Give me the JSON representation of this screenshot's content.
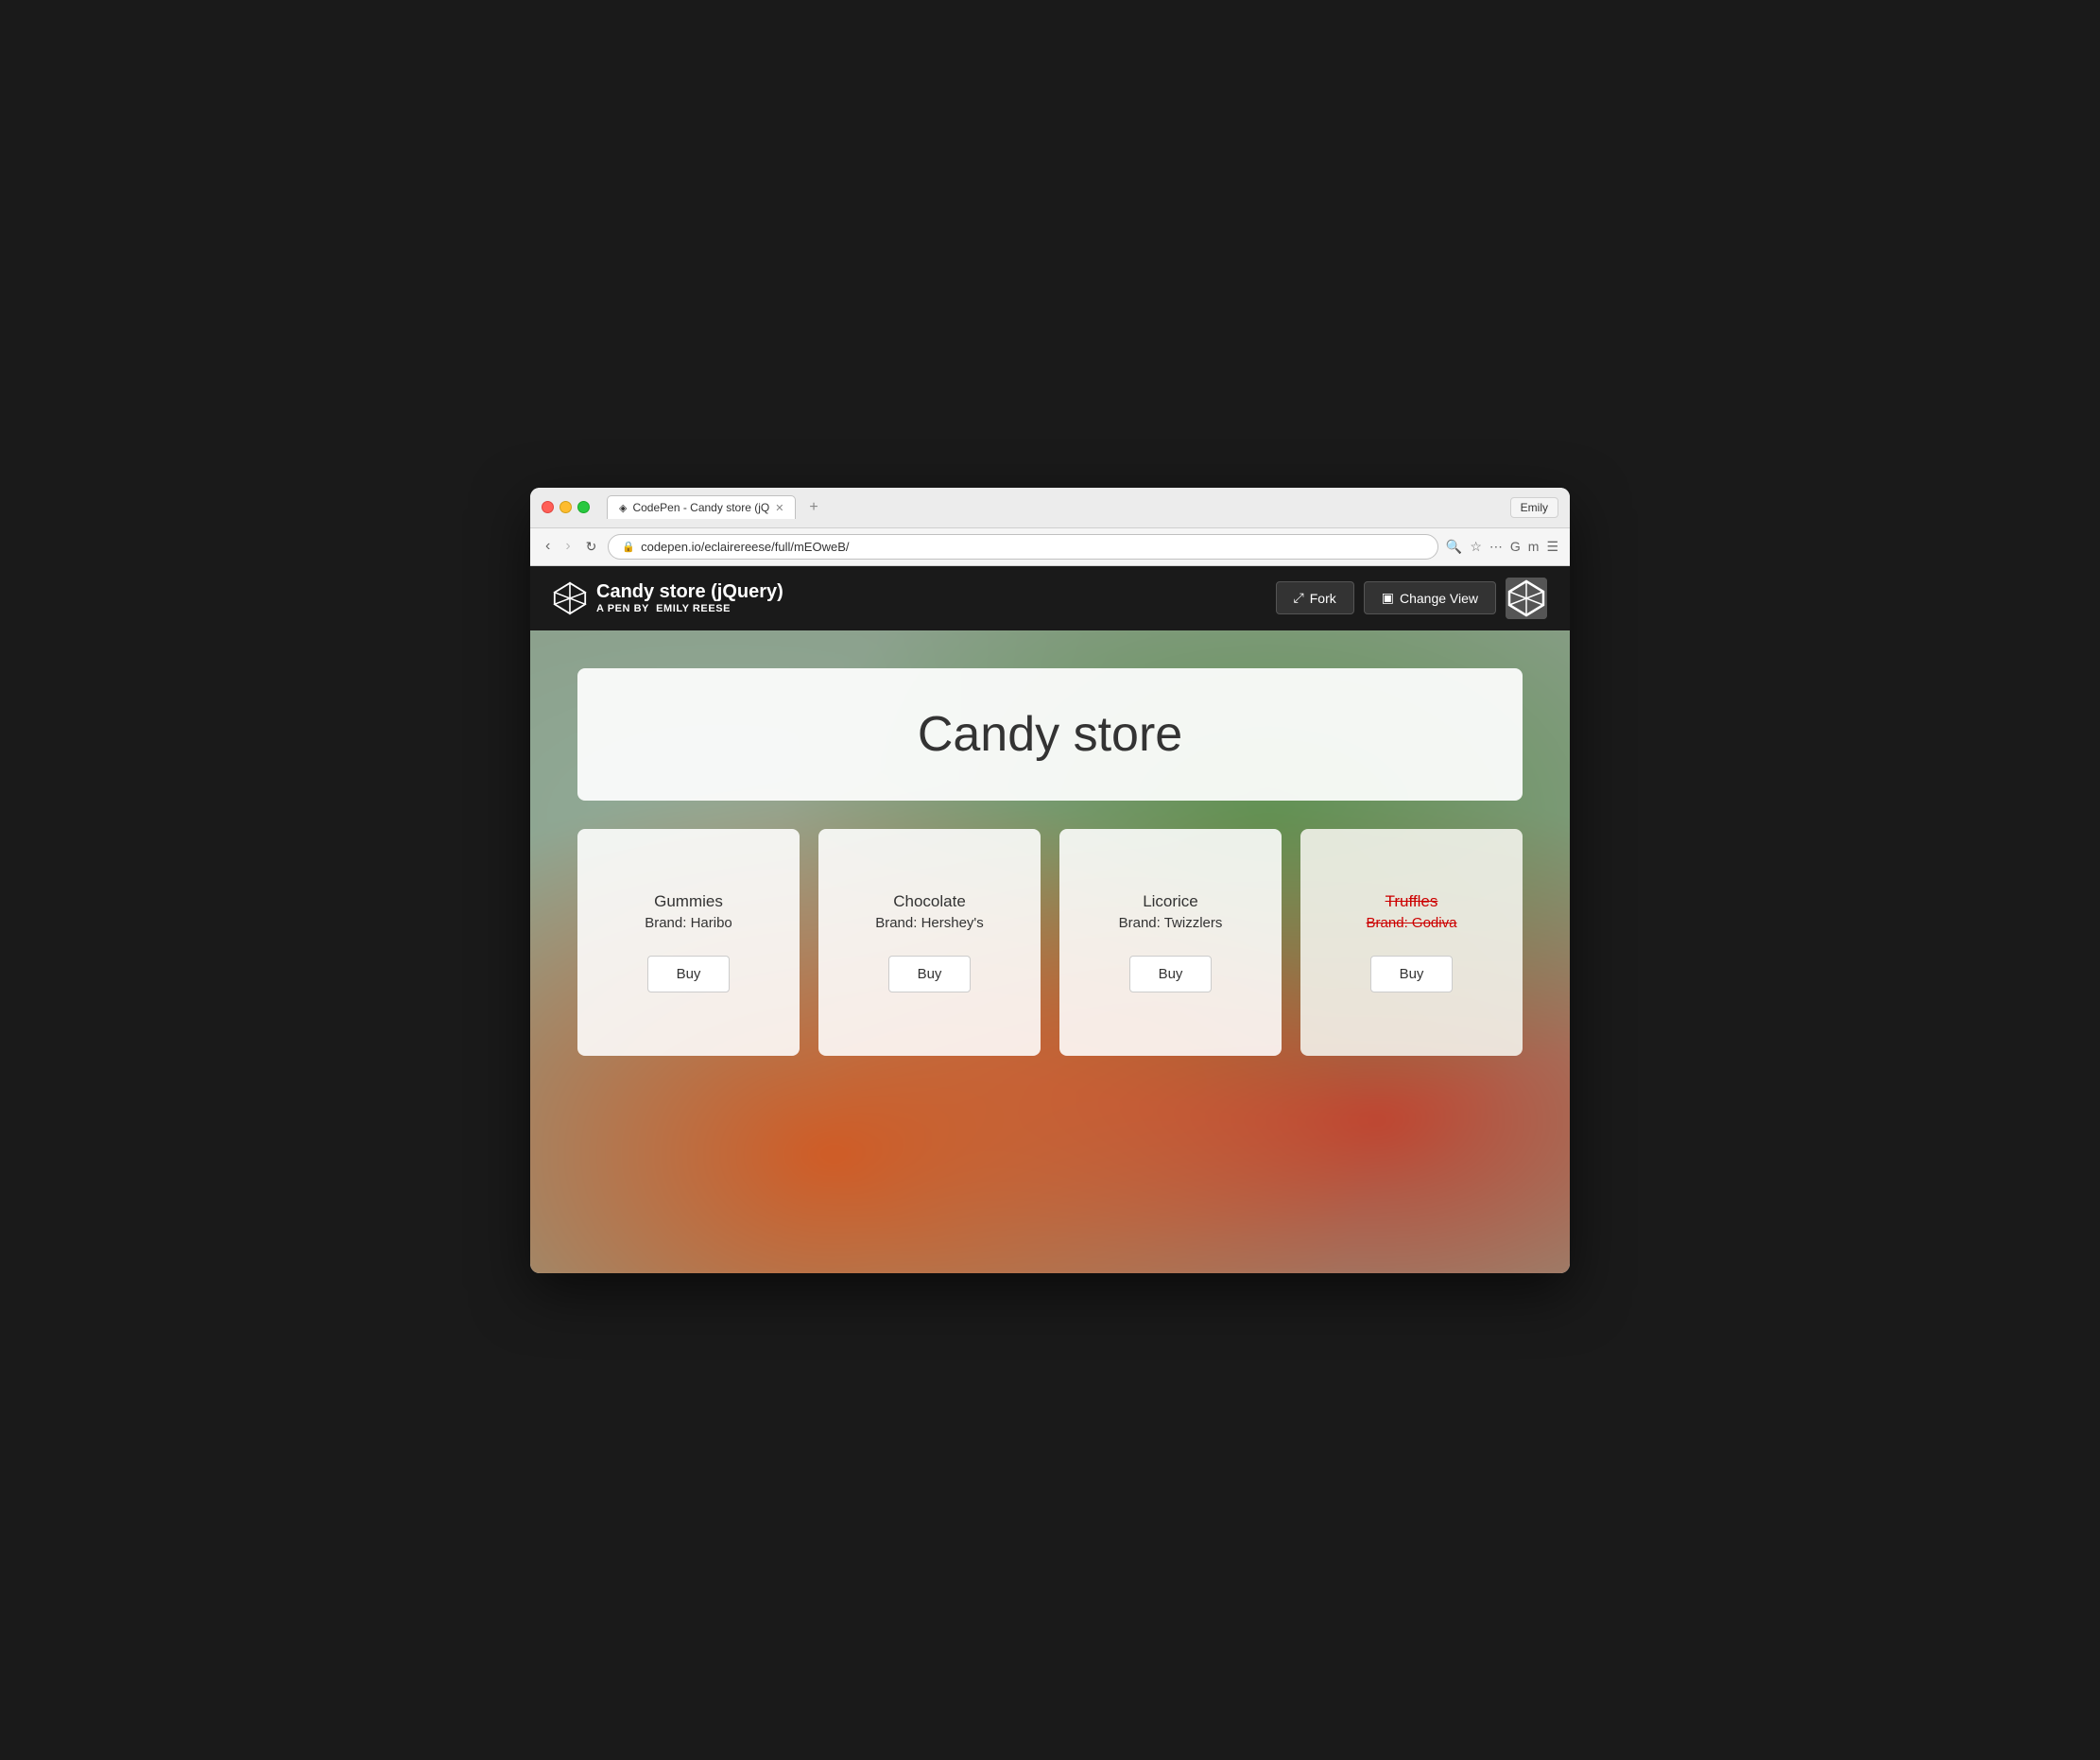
{
  "browser": {
    "user": "Emily",
    "tab": {
      "title": "CodePen - Candy store (jQ",
      "icon": "◈"
    },
    "url": "codepen.io/eclairereese/full/mEOweB/",
    "nav": {
      "back": "←",
      "forward": "→",
      "reload": "↻"
    }
  },
  "codepen": {
    "logo_icon": "◈",
    "pen_title": "Candy store (jQuery)",
    "author_label": "A PEN BY",
    "author_name": "Emily Reese",
    "fork_label": "Fork",
    "fork_icon": "⤢",
    "change_view_label": "Change View",
    "change_view_icon": "▣"
  },
  "store": {
    "title": "Candy store",
    "products": [
      {
        "name": "Gummies",
        "brand": "Brand: Haribo",
        "buy_label": "Buy",
        "sold_out": false
      },
      {
        "name": "Chocolate",
        "brand": "Brand: Hershey's",
        "buy_label": "Buy",
        "sold_out": false
      },
      {
        "name": "Licorice",
        "brand": "Brand: Twizzlers",
        "buy_label": "Buy",
        "sold_out": false
      },
      {
        "name": "Truffles",
        "brand": "Brand: Godiva",
        "buy_label": "Buy",
        "sold_out": true
      }
    ]
  }
}
